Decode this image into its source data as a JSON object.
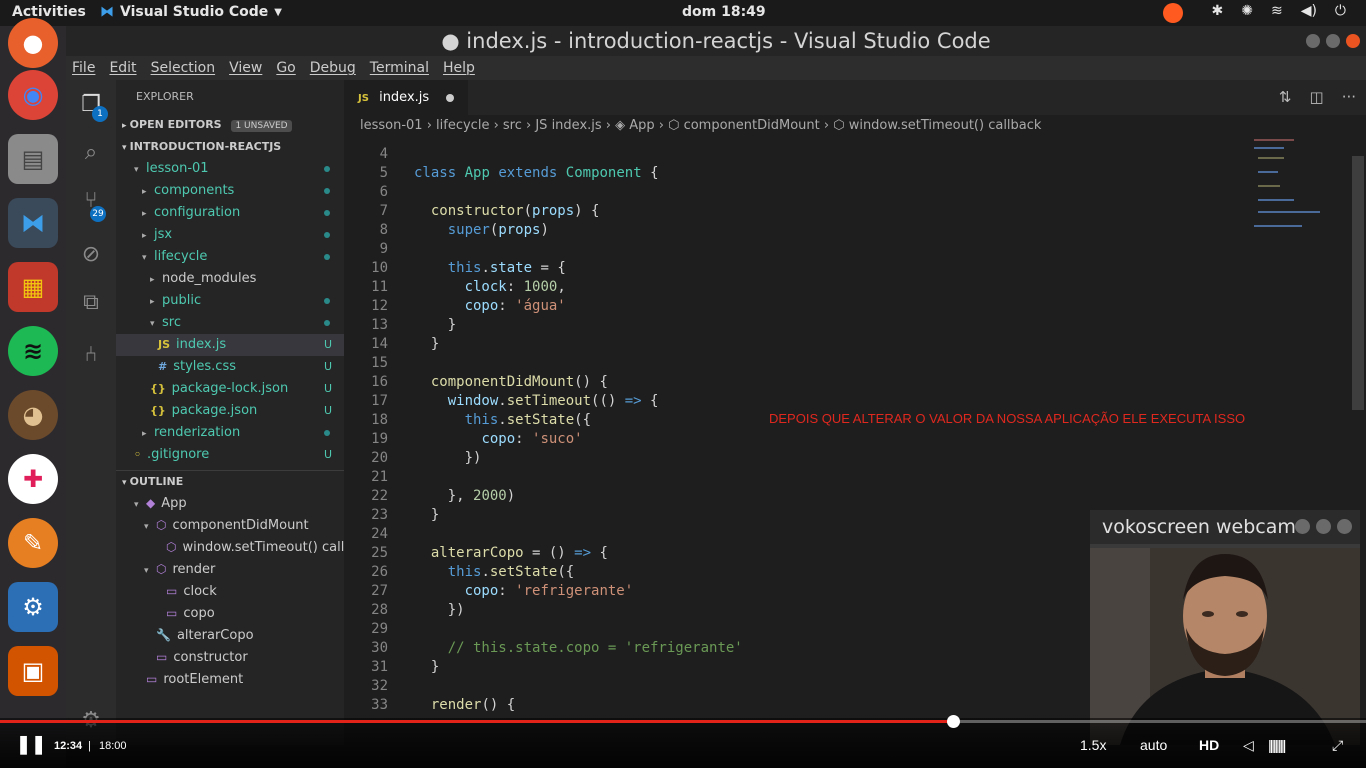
{
  "topbar": {
    "activities": "Activities",
    "app_menu": "Visual Studio Code",
    "clock": "dom 18:49"
  },
  "window": {
    "title": "● index.js - introduction-reactjs - Visual Studio Code"
  },
  "menubar": [
    "File",
    "Edit",
    "Selection",
    "View",
    "Go",
    "Debug",
    "Terminal",
    "Help"
  ],
  "activitybar": {
    "explorer_badge": "1",
    "scm_badge": "29"
  },
  "sidebar": {
    "header": "EXPLORER",
    "open_editors": "OPEN EDITORS",
    "unsaved": "1 UNSAVED",
    "project": "INTRODUCTION-REACTJS",
    "tree": [
      {
        "name": "lesson-01",
        "depth": 0,
        "arrow": "▾",
        "dot": true,
        "cls": "teal"
      },
      {
        "name": "components",
        "depth": 1,
        "arrow": "▸",
        "dot": true,
        "cls": "teal"
      },
      {
        "name": "configuration",
        "depth": 1,
        "arrow": "▸",
        "dot": true,
        "cls": "teal"
      },
      {
        "name": "jsx",
        "depth": 1,
        "arrow": "▸",
        "dot": true,
        "cls": "teal"
      },
      {
        "name": "lifecycle",
        "depth": 1,
        "arrow": "▾",
        "dot": true,
        "cls": "teal"
      },
      {
        "name": "node_modules",
        "depth": 2,
        "arrow": "▸",
        "dot": false,
        "cls": ""
      },
      {
        "name": "public",
        "depth": 2,
        "arrow": "▸",
        "dot": true,
        "cls": "teal"
      },
      {
        "name": "src",
        "depth": 2,
        "arrow": "▾",
        "dot": true,
        "cls": "teal"
      },
      {
        "name": "index.js",
        "depth": 3,
        "icon": "JS",
        "status": "U",
        "cls": "teal",
        "sel": true
      },
      {
        "name": "styles.css",
        "depth": 3,
        "icon": "#",
        "status": "U",
        "cls": "teal"
      },
      {
        "name": "package-lock.json",
        "depth": 2,
        "icon": "{}",
        "status": "U",
        "cls": "teal"
      },
      {
        "name": "package.json",
        "depth": 2,
        "icon": "{}",
        "status": "U",
        "cls": "teal"
      },
      {
        "name": "renderization",
        "depth": 1,
        "arrow": "▸",
        "dot": true,
        "cls": "teal"
      },
      {
        "name": ".gitignore",
        "depth": 0,
        "icon": "◦",
        "status": "U",
        "cls": "teal"
      }
    ],
    "outline_header": "OUTLINE",
    "outline": [
      {
        "name": "App",
        "depth": 0,
        "arrow": "▾",
        "icon": "◆"
      },
      {
        "name": "componentDidMount",
        "depth": 1,
        "arrow": "▾",
        "icon": "⬡"
      },
      {
        "name": "window.setTimeout() call...",
        "depth": 2,
        "arrow": "",
        "icon": "⬡"
      },
      {
        "name": "render",
        "depth": 1,
        "arrow": "▾",
        "icon": "⬡"
      },
      {
        "name": "clock",
        "depth": 2,
        "arrow": "",
        "icon": "▭"
      },
      {
        "name": "copo",
        "depth": 2,
        "arrow": "",
        "icon": "▭"
      },
      {
        "name": "alterarCopo",
        "depth": 1,
        "arrow": "",
        "icon": "🔧"
      },
      {
        "name": "constructor",
        "depth": 1,
        "arrow": "",
        "icon": "▭"
      },
      {
        "name": "rootElement",
        "depth": 0,
        "arrow": "",
        "icon": "▭"
      }
    ]
  },
  "editor": {
    "tab_label": "index.js",
    "breadcrumb": "lesson-01 › lifecycle › src › JS index.js › ◈ App › ⬡ componentDidMount › ⬡ window.setTimeout() callback",
    "lines": [
      {
        "n": "4",
        "h": ""
      },
      {
        "n": "5",
        "h": "<span class='k'>class</span> <span class='c'>App</span> <span class='k'>extends</span> <span class='c'>Component</span> {"
      },
      {
        "n": "6",
        "h": ""
      },
      {
        "n": "7",
        "h": "  <span class='f'>constructor</span>(<span class='p'>props</span>) {"
      },
      {
        "n": "8",
        "h": "    <span class='k'>super</span>(<span class='p'>props</span>)"
      },
      {
        "n": "9",
        "h": ""
      },
      {
        "n": "10",
        "h": "    <span class='k'>this</span>.<span class='p'>state</span> = {"
      },
      {
        "n": "11",
        "h": "      <span class='p'>clock</span>: <span class='n'>1000</span>,"
      },
      {
        "n": "12",
        "h": "      <span class='p'>copo</span>: <span class='s'>'água'</span>"
      },
      {
        "n": "13",
        "h": "    }"
      },
      {
        "n": "14",
        "h": "  }"
      },
      {
        "n": "15",
        "h": ""
      },
      {
        "n": "16",
        "h": "  <span class='f'>componentDidMount</span>() {"
      },
      {
        "n": "17",
        "h": "    <span class='p'>window</span>.<span class='f'>setTimeout</span>(() <span class='k'>=&gt;</span> {"
      },
      {
        "n": "18",
        "h": "      <span class='k'>this</span>.<span class='f'>setState</span>({"
      },
      {
        "n": "19",
        "h": "        <span class='p'>copo</span>: <span class='s'>'suco'</span>"
      },
      {
        "n": "20",
        "h": "      })"
      },
      {
        "n": "21",
        "h": ""
      },
      {
        "n": "22",
        "h": "    }, <span class='n'>2000</span>)"
      },
      {
        "n": "23",
        "h": "  }"
      },
      {
        "n": "24",
        "h": ""
      },
      {
        "n": "25",
        "h": "  <span class='f'>alterarCopo</span> = () <span class='k'>=&gt;</span> {"
      },
      {
        "n": "26",
        "h": "    <span class='k'>this</span>.<span class='f'>setState</span>({"
      },
      {
        "n": "27",
        "h": "      <span class='p'>copo</span>: <span class='s'>'refrigerante'</span>"
      },
      {
        "n": "28",
        "h": "    })"
      },
      {
        "n": "29",
        "h": ""
      },
      {
        "n": "30",
        "h": "    <span class='cm'>// this.state.copo = 'refrigerante'</span>"
      },
      {
        "n": "31",
        "h": "  }"
      },
      {
        "n": "32",
        "h": ""
      },
      {
        "n": "33",
        "h": "  <span class='f'>render</span>() {"
      }
    ],
    "annotation": "DEPOIS QUE ALTERAR O VALOR DA NOSSA APLICAÇÃO ELE EXECUTA ISSO"
  },
  "webcam": {
    "title": "vokoscreen webcam"
  },
  "player": {
    "current": "12:34",
    "sep": "|",
    "duration": "18:00",
    "progress": 0.698,
    "speed": "1.5x",
    "quality_auto": "auto",
    "hd": "HD"
  }
}
